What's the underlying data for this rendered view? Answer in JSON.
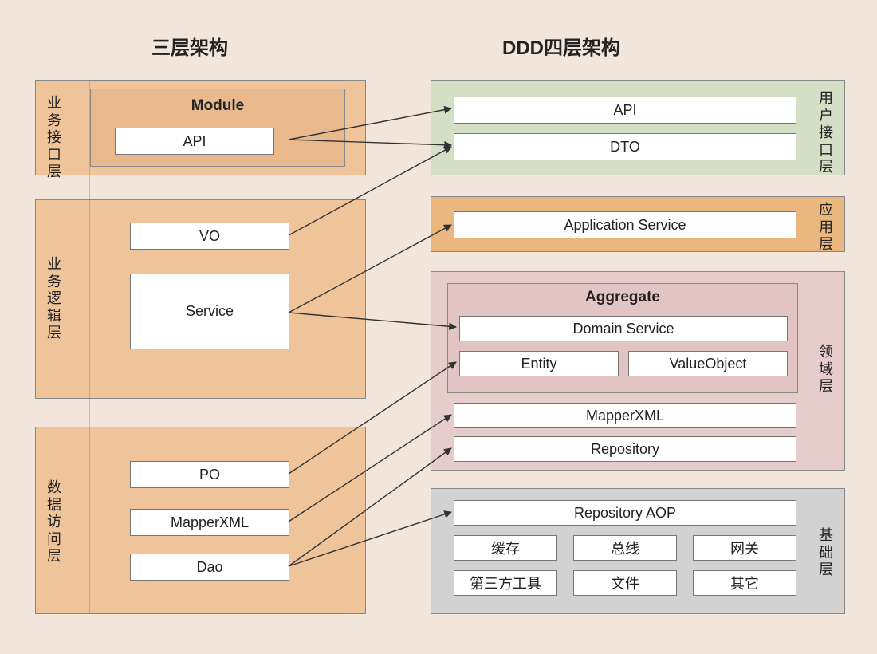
{
  "titles": {
    "left": "三层架构",
    "right": "DDD四层架构"
  },
  "left": {
    "layer1": {
      "label": "业务接口层",
      "moduleTitle": "Module",
      "api": "API"
    },
    "layer2": {
      "label": "业务逻辑层",
      "vo": "VO",
      "service": "Service"
    },
    "layer3": {
      "label": "数据访问层",
      "po": "PO",
      "mapper": "MapperXML",
      "dao": "Dao"
    }
  },
  "right": {
    "layer1": {
      "label": "用户接口层",
      "api": "API",
      "dto": "DTO"
    },
    "layer2": {
      "label": "应用层",
      "appService": "Application Service"
    },
    "layer3": {
      "label": "领域层",
      "aggTitle": "Aggregate",
      "domainService": "Domain Service",
      "entity": "Entity",
      "valueObject": "ValueObject",
      "mapper": "MapperXML",
      "repo": "Repository"
    },
    "layer4": {
      "label": "基础层",
      "repoAop": "Repository AOP",
      "cache": "缓存",
      "bus": "总线",
      "gateway": "网关",
      "thirdparty": "第三方工具",
      "file": "文件",
      "other": "其它"
    }
  },
  "colors": {
    "leftLayer": "#f0c49b",
    "leftModule": "#e9b98d",
    "rightL1": "#d5dfc5",
    "rightL2": "#eab87f",
    "rightL3": "#e6cccb",
    "rightAgg": "#e1c4c3",
    "rightL4": "#d2d2d2"
  }
}
